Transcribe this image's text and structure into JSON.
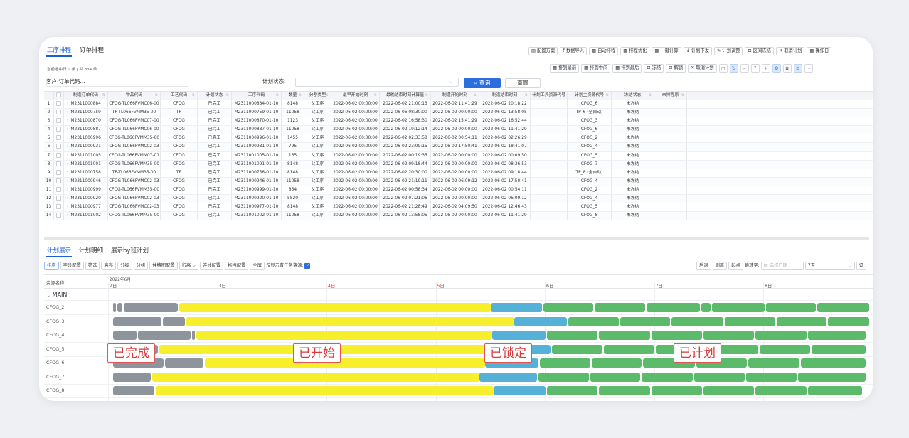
{
  "tabs": {
    "proc": "工序排程",
    "order": "订单排程"
  },
  "toolbar1": [
    "配置方案",
    "数据导入",
    "自动排程",
    "排程优化",
    "一键计算",
    "计划下发",
    "计划调整",
    "区间冻结",
    "取消计划",
    "操作日"
  ],
  "toolbar2": [
    "排到最前",
    "排到中间",
    "排到最后",
    "冻结",
    "解锁",
    "取消计划"
  ],
  "info": "当前选中行 0 条 | 共 334 条",
  "filter": {
    "customer_label": "客户|订单代码...",
    "status_label": "计划状态:",
    "query": "查询",
    "reset": "重置"
  },
  "headers": [
    "制造订单代码",
    "物品代码",
    "工艺代码",
    "计划状态",
    "工序代码",
    "数量",
    "分割类型",
    "最早开始时刻",
    "最晚结束时刻计算值",
    "制造开始时刻",
    "制造结束时刻",
    "计划工具资源代号",
    "计划主资源代号",
    "冻结状态",
    "未排程原"
  ],
  "rows": [
    [
      "1",
      "M2311000884",
      "CFOG-TL066FVMC06-00",
      "CFOG",
      "已完工",
      "M2311000884-01-10",
      "8148",
      "父工序",
      "2022-06-02 00:00:00",
      "2022-06-02 21:00:13",
      "2022-06-02 11:41:29",
      "2022-06-02 20:18:22",
      "",
      "CFOG_6",
      "未冻结"
    ],
    [
      "2",
      "M2311000759",
      "TP-TL066FVMM35-00",
      "TP",
      "已完工",
      "M2311000759-01-10",
      "11058",
      "父工序",
      "2022-06-02 00:00:00",
      "2022-06-06 08:30:00",
      "2022-06-02 00:00:00",
      "2022-06-02 13:58:05",
      "",
      "TP_6 (全自动)",
      "未冻结"
    ],
    [
      "3",
      "M2311000870",
      "CFOG-TL066FVMC07-00",
      "CFOG",
      "已完工",
      "M2311000870-01-10",
      "1123",
      "父工序",
      "2022-06-02 00:00:00",
      "2022-06-02 16:58:30",
      "2022-06-02 15:41:29",
      "2022-06-02 16:52:44",
      "",
      "CFOG_3",
      "未冻结"
    ],
    [
      "4",
      "M2311000887",
      "CFOG-TL066FVMC06-00",
      "CFOG",
      "已完工",
      "M2311000887-01-10",
      "11058",
      "父工序",
      "2022-06-02 00:00:00",
      "2022-06-02 19:12:14",
      "2022-06-02 00:00:00",
      "2022-06-02 11:41:29",
      "",
      "CFOG_6",
      "未冻结"
    ],
    [
      "5",
      "M2311000996",
      "CFOG-TL066FVMM35-00",
      "CFOG",
      "已完工",
      "M2311000996-01-10",
      "1455",
      "父工序",
      "2022-06-02 00:00:00",
      "2022-06-02 02:33:58",
      "2022-06-02 00:54:11",
      "2022-06-02 02:26:29",
      "",
      "CFOG_2",
      "未冻结"
    ],
    [
      "6",
      "M2311000931",
      "CFOG-TL066FVMC02-03",
      "CFOG",
      "已完工",
      "M2311000931-01-10",
      "795",
      "父工序",
      "2022-06-02 00:00:00",
      "2022-06-02 23:09:15",
      "2022-06-02 17:50:41",
      "2022-06-02 18:41:07",
      "",
      "CFOG_4",
      "未冻结"
    ],
    [
      "7",
      "M2311001005",
      "CFOG-TL066FVMM07-01",
      "CFOG",
      "已完工",
      "M2311001005-01-10",
      "155",
      "父工序",
      "2022-06-02 00:00:00",
      "2022-06-02 00:19:35",
      "2022-06-02 00:00:00",
      "2022-06-02 00:09:50",
      "",
      "CFOG_5",
      "未冻结"
    ],
    [
      "8",
      "M2311001001",
      "CFOG-TL066FVMM35-00",
      "CFOG",
      "已完工",
      "M2311001001-01-10",
      "8148",
      "父工序",
      "2022-06-02 00:00:00",
      "2022-06-02 09:18:44",
      "2022-06-02 00:00:00",
      "2022-06-02 08:36:53",
      "",
      "CFOG_7",
      "未冻结"
    ],
    [
      "9",
      "M2311000758",
      "TP-TL066FVMM35-00",
      "TP",
      "已完工",
      "M2311000758-01-10",
      "8148",
      "父工序",
      "2022-06-02 00:00:00",
      "2022-06-02 20:30:00",
      "2022-06-02 00:00:00",
      "2022-06-02 09:18:44",
      "",
      "TP_8 (全自动)",
      "未冻结"
    ],
    [
      "10",
      "M2311000946",
      "CFOG-TL066FVMC02-03",
      "CFOG",
      "已完工",
      "M2311000946-01-10",
      "11058",
      "父工序",
      "2022-06-02 00:00:00",
      "2022-06-02 21:19:11",
      "2022-06-02 06:09:12",
      "2022-06-02 17:50:41",
      "",
      "CFOG_4",
      "未冻结"
    ],
    [
      "11",
      "M2311000999",
      "CFOG-TL066FVMM35-00",
      "CFOG",
      "已完工",
      "M2311000999-01-10",
      "854",
      "父工序",
      "2022-06-02 00:00:00",
      "2022-06-02 00:58:34",
      "2022-06-02 00:00:00",
      "2022-06-02 00:54:11",
      "",
      "CFOG_2",
      "未冻结"
    ],
    [
      "12",
      "M2311000920",
      "CFOG-TL066FVMC02-03",
      "CFOG",
      "已完工",
      "M2311000920-01-10",
      "5820",
      "父工序",
      "2022-06-02 00:00:00",
      "2022-06-02 07:21:06",
      "2022-06-02 00:00:00",
      "2022-06-02 06:09:12",
      "",
      "CFOG_4",
      "未冻结"
    ],
    [
      "13",
      "M2311000977",
      "CFOG-TL066FVMC02-03",
      "CFOG",
      "已完工",
      "M2311000977-01-10",
      "8148",
      "父工序",
      "2022-06-02 00:00:00",
      "2022-06-02 21:28:49",
      "2022-06-02 04:09:50",
      "2022-06-02 12:46:43",
      "",
      "CFOG_5",
      "未冻结"
    ],
    [
      "14",
      "M2311001002",
      "CFOG-TL066FVMM35-00",
      "CFOG",
      "已完工",
      "M2311001002-01-10",
      "11058",
      "父工序",
      "2022-06-02 00:00:00",
      "2022-06-02 13:58:05",
      "2022-06-02 00:00:00",
      "2022-06-02 11:41:29",
      "",
      "CFOG_8",
      "未冻结"
    ]
  ],
  "tabs2": [
    "计划展示",
    "计划明细",
    "展示by班计划"
  ],
  "gantt_toolbar": [
    "排序",
    "字段配置",
    "筛选",
    "高亮",
    "分级",
    "分组",
    "甘特图配置",
    "行高",
    "连线配置",
    "拖拽配置",
    "全屏",
    "仅显示有任务资源:"
  ],
  "gantt_right": {
    "back": "后退",
    "refresh": "刷新",
    "start": "起点",
    "jump": "跳转至:",
    "date_ph": "选择日期",
    "range": "7天",
    "set": "设"
  },
  "gantt": {
    "res_header": "资源名称",
    "month": "2022年6月",
    "days": [
      "2日",
      "3日",
      "4日",
      "5日",
      "6日",
      "7日",
      "8日"
    ],
    "group": "MAIN",
    "resources": [
      "CFOG_2",
      "CFOG_3",
      "CFOG_4",
      "CFOG_5",
      "CFOG_6",
      "CFOG_7",
      "CFOG_8"
    ]
  },
  "colors": {
    "gray": "#8e949c",
    "yellow": "#f7ee2c",
    "blue": "#56b1d8",
    "green": "#5bbb6b",
    "accent": "#2c6de0",
    "red_day": "#e33"
  },
  "callouts": [
    "已完成",
    "已开始",
    "已锁定",
    "已计划"
  ]
}
